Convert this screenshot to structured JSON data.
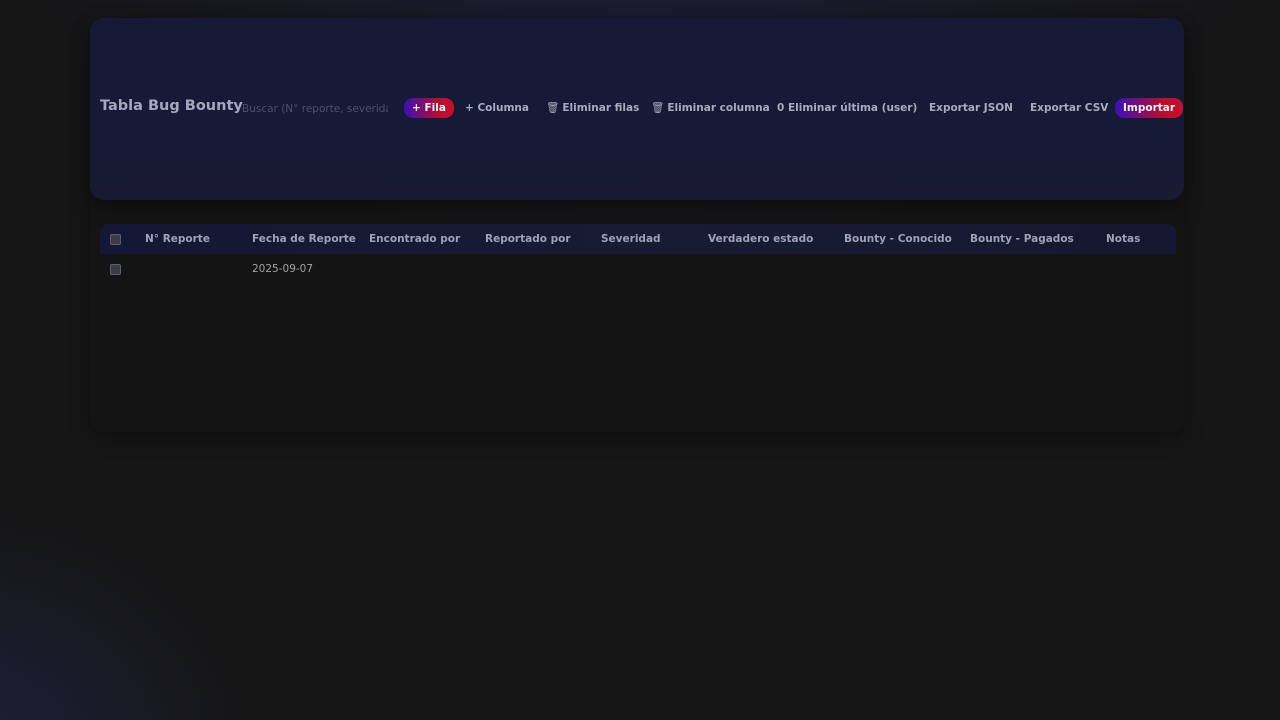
{
  "app": {
    "title": "Tabla Bug Bounty"
  },
  "search": {
    "placeholder": "Buscar (N° reporte, severidad...)",
    "value": ""
  },
  "toolbar": {
    "add_row": "+ Fila",
    "add_column": "+ Columna",
    "delete_rows_icon": "🗑",
    "delete_rows": "Eliminar filas",
    "delete_column_icon": "🗑",
    "delete_column": "Eliminar columna",
    "delete_last": "0 Eliminar última (user)",
    "export_json": "Exportar JSON",
    "export_csv": "Exportar CSV",
    "import": "Importar"
  },
  "table": {
    "columns": [
      "N° Reporte",
      "Fecha de Reporte",
      "Encontrado por",
      "Reportado por",
      "Severidad",
      "Verdadero estado",
      "Bounty - Conocido",
      "Bounty - Pagados",
      "Notas"
    ],
    "rows": [
      {
        "selected": false,
        "cells": [
          "",
          "2025-09-07",
          "",
          "",
          "",
          "",
          "",
          "",
          ""
        ]
      }
    ]
  },
  "colors": {
    "accent_start": "#3b0fb8",
    "accent_end": "#c8102a",
    "background": "#161616",
    "header_bg": "#151936"
  },
  "icons": {
    "delete": "trash-icon"
  }
}
